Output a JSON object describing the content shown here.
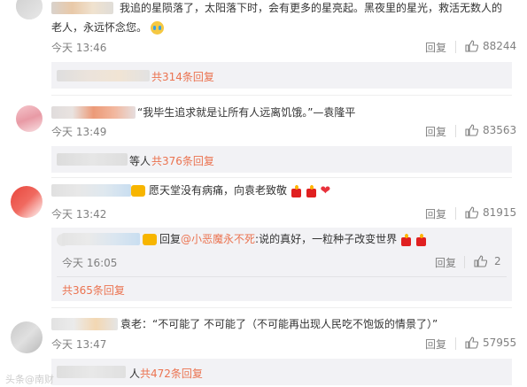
{
  "comments": [
    {
      "text_line1": "我追的星陨落了，太阳落下时，会有更多的星亮起。黑夜里的星光，救活无数人的",
      "text_line2": "老人，永远怀念您。",
      "time": "今天 13:46",
      "reply_label": "回复",
      "likes": "88244",
      "subreplies": "共314条回复"
    },
    {
      "text": "“我毕生追求就是让所有人远离饥饿。”—袁隆平",
      "time": "今天 13:49",
      "reply_label": "回复",
      "likes": "83563",
      "subreplies_prefix": "等人",
      "subreplies": "共376条回复"
    },
    {
      "text": "愿天堂没有病痛，向袁老致敬",
      "time": "今天 13:42",
      "reply_label": "回复",
      "likes": "81915",
      "subreply": {
        "prefix": "回复",
        "mention": "@小恶魔永不死",
        "text": ":说的真好，一粒种子改变世界",
        "time": "今天 16:05",
        "reply_label": "回复",
        "likes": "2"
      },
      "subreplies": "共365条回复"
    },
    {
      "text": "袁老：“不可能了 不可能了（不可能再出现人民吃不饱饭的情景了）”",
      "time": "今天 13:47",
      "reply_label": "回复",
      "likes": "57955",
      "subreplies_prefix": "人",
      "subreplies": "共472条回复"
    }
  ],
  "watermark": "头条@南财",
  "colors": {
    "link": "#eb7350",
    "meta": "#808080",
    "subbox": "#f2f2f5"
  }
}
